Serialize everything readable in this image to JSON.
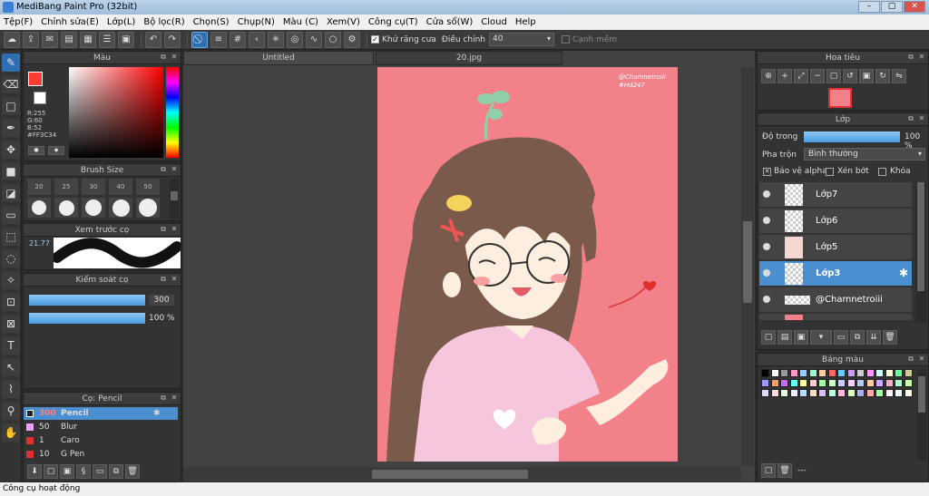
{
  "window": {
    "title": "MediBang Paint Pro (32bit)"
  },
  "menu": [
    "Tệp(F)",
    "Chỉnh sửa(E)",
    "Lớp(L)",
    "Bộ lọc(R)",
    "Chọn(S)",
    "Chụp(N)",
    "Màu (C)",
    "Xem(V)",
    "Công cụ(T)",
    "Cửa sổ(W)",
    "Cloud",
    "Help"
  ],
  "toolbar": {
    "antialias_label": "Khử răng cưa",
    "adjust_label": "Điều chỉnh",
    "adjust_value": "40",
    "smooth_label": "Cạnh mềm"
  },
  "color_panel": {
    "title": "Màu",
    "r": "R:255",
    "g": "G:60",
    "b": "B:52",
    "hex": "#FF3C34",
    "fg": "#ff3c34"
  },
  "brush_size": {
    "title": "Brush Size",
    "sizes": [
      "20",
      "25",
      "30",
      "40",
      "50"
    ]
  },
  "preview": {
    "title": "Xem trước cọ",
    "value": "21.77"
  },
  "brush_control": {
    "title": "Kiểm soát cọ",
    "size": "300",
    "opacity": "100 %"
  },
  "brush_list": {
    "title": "Cọ: Pencil",
    "items": [
      {
        "size": "300",
        "name": "Pencil",
        "color": "#222222",
        "selected": true
      },
      {
        "size": "50",
        "name": "Blur",
        "color": "#e8a0f0",
        "selected": false
      },
      {
        "size": "1",
        "name": "Caro",
        "color": "#e03030",
        "selected": false
      },
      {
        "size": "10",
        "name": "G Pen",
        "color": "#e03030",
        "selected": false
      }
    ]
  },
  "tabs": [
    {
      "label": "Untitled"
    },
    {
      "label": "20.jpg"
    }
  ],
  "artwork": {
    "watermark1": "@Chamnetroiii",
    "watermark2": "#Hd247"
  },
  "navigator": {
    "title": "Hoa tiêu"
  },
  "layer_panel": {
    "title": "Lớp",
    "opacity_label": "Độ trong",
    "opacity_value": "100 %",
    "blend_label": "Pha trộn",
    "blend_value": "Bình thường",
    "protect_alpha": "Bảo vệ alpha",
    "clip": "Xén bớt",
    "lock": "Khóa",
    "layers": [
      {
        "name": "Lớp7"
      },
      {
        "name": "Lớp6"
      },
      {
        "name": "Lớp5"
      },
      {
        "name": "Lớp3"
      },
      {
        "name": "@Chamnetroiii"
      }
    ]
  },
  "palette": {
    "title": "Bảng màu",
    "footer": "---"
  },
  "status": {
    "text": "Công cụ hoạt động"
  }
}
